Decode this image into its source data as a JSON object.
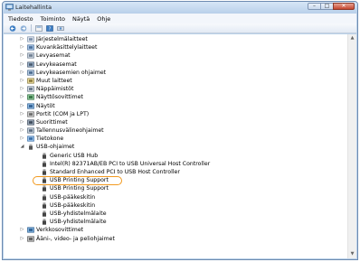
{
  "window": {
    "title": "Laitehallinta",
    "controls": {
      "minimize": "–",
      "maximize": "□",
      "close": "✕"
    }
  },
  "menu": [
    "Tiedosto",
    "Toiminto",
    "Näytä",
    "Ohje"
  ],
  "toolbar": [
    "back-icon",
    "forward-icon",
    "properties-icon",
    "help-icon",
    "device-icon"
  ],
  "tree": [
    {
      "label": "Järjestelmälaitteet",
      "indent": 0,
      "twisty": "▷",
      "icon": "system-icon"
    },
    {
      "label": "Kuvankäsittelylaitteet",
      "indent": 0,
      "twisty": "▷",
      "icon": "imaging-icon"
    },
    {
      "label": "Levyasemat",
      "indent": 0,
      "twisty": "▷",
      "icon": "disk-icon"
    },
    {
      "label": "Levykeasemat",
      "indent": 0,
      "twisty": "▷",
      "icon": "floppy-icon"
    },
    {
      "label": "Levykeasemien ohjaimet",
      "indent": 0,
      "twisty": "▷",
      "icon": "floppy-controller-icon"
    },
    {
      "label": "Muut laitteet",
      "indent": 0,
      "twisty": "▷",
      "icon": "other-device-icon"
    },
    {
      "label": "Näppäimistöt",
      "indent": 0,
      "twisty": "▷",
      "icon": "keyboard-icon"
    },
    {
      "label": "Näyttösovittimet",
      "indent": 0,
      "twisty": "▷",
      "icon": "display-adapter-icon"
    },
    {
      "label": "Näytöt",
      "indent": 0,
      "twisty": "▷",
      "icon": "monitor-icon"
    },
    {
      "label": "Portit (COM ja LPT)",
      "indent": 0,
      "twisty": "▷",
      "icon": "port-icon"
    },
    {
      "label": "Suorittimet",
      "indent": 0,
      "twisty": "▷",
      "icon": "processor-icon"
    },
    {
      "label": "Tallennusvälineohjaimet",
      "indent": 0,
      "twisty": "▷",
      "icon": "storage-controller-icon"
    },
    {
      "label": "Tietokone",
      "indent": 0,
      "twisty": "▷",
      "icon": "computer-icon"
    },
    {
      "label": "USB-ohjaimet",
      "indent": 0,
      "twisty": "◢",
      "icon": "usb-controller-icon"
    },
    {
      "label": "Generic USB Hub",
      "indent": 1,
      "twisty": "",
      "icon": "usb-device-icon"
    },
    {
      "label": "Intel(R) 82371AB/EB PCI to USB Universal Host Controller",
      "indent": 1,
      "twisty": "",
      "icon": "usb-device-icon"
    },
    {
      "label": "Standard Enhanced PCI to USB Host Controller",
      "indent": 1,
      "twisty": "",
      "icon": "usb-device-icon"
    },
    {
      "label": "USB Printing Support",
      "indent": 1,
      "twisty": "",
      "icon": "usb-device-icon"
    },
    {
      "label": "USB Printing Support",
      "indent": 1,
      "twisty": "",
      "icon": "usb-device-icon"
    },
    {
      "label": "USB-pääkeskitin",
      "indent": 1,
      "twisty": "",
      "icon": "usb-device-icon"
    },
    {
      "label": "USB-pääkeskitin",
      "indent": 1,
      "twisty": "",
      "icon": "usb-device-icon"
    },
    {
      "label": "USB-yhdistelmälaite",
      "indent": 1,
      "twisty": "",
      "icon": "usb-device-icon"
    },
    {
      "label": "USB-yhdistelmälaite",
      "indent": 1,
      "twisty": "",
      "icon": "usb-device-icon"
    },
    {
      "label": "Verkkosovittimet",
      "indent": 0,
      "twisty": "▷",
      "icon": "network-adapter-icon"
    },
    {
      "label": "Ääni-, video- ja peliohjaimet",
      "indent": 0,
      "twisty": "▷",
      "icon": "sound-icon"
    }
  ],
  "highlighted_item": "USB Printing Support",
  "colors": {
    "highlight": "#f29a1f",
    "window_frame": "#bcd2ea"
  }
}
